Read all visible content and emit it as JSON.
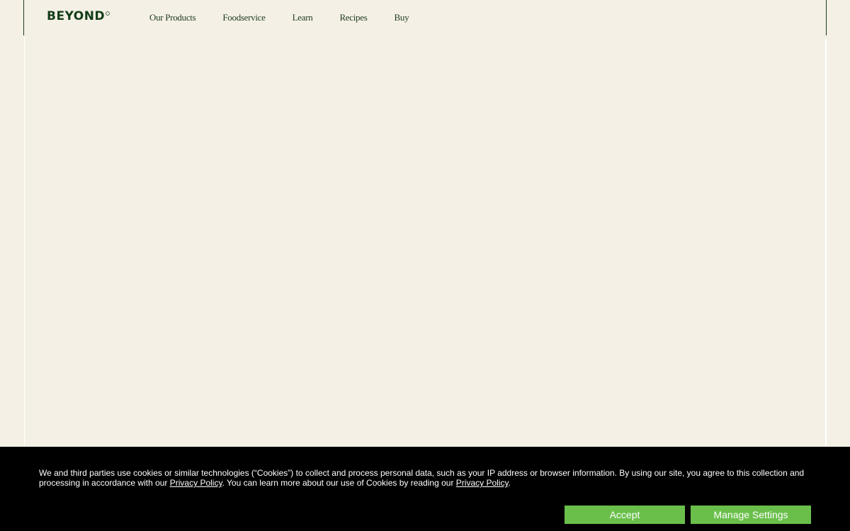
{
  "header": {
    "logo_text": "BEYOND",
    "nav": [
      {
        "label": "Our Products"
      },
      {
        "label": "Foodservice"
      },
      {
        "label": "Learn"
      },
      {
        "label": "Recipes"
      },
      {
        "label": "Buy"
      }
    ]
  },
  "cookie_banner": {
    "text_part1": "We and third parties use cookies or similar technologies (“Cookies”) to collect and process personal data, such as your IP address or browser information. By using our site, you agree to this collection and processing in accordance with our ",
    "privacy_link_1": "Privacy Policy",
    "text_part2": ". You can learn more about our use of Cookies by reading our ",
    "privacy_link_2": "Privacy Policy",
    "text_part3": ".",
    "accept_label": "Accept",
    "manage_label": "Manage Settings"
  },
  "colors": {
    "page_background": "#f4f0e5",
    "brand_green": "#123d17",
    "banner_background": "#000000",
    "button_green": "#6abf4b"
  }
}
